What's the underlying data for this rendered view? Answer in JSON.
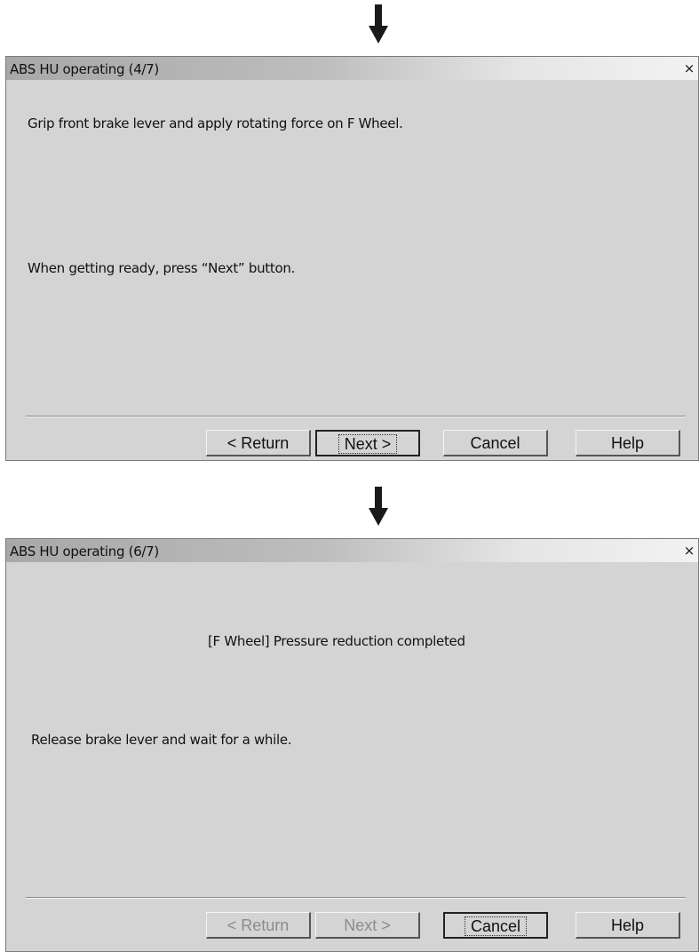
{
  "dialog1": {
    "title": "ABS HU operating (4/7)",
    "close_label": "×",
    "instruction": "Grip front brake lever and apply rotating force on F Wheel.",
    "prompt": "When getting ready, press “Next” button.",
    "buttons": {
      "return": "< Return",
      "next": "Next >",
      "cancel": "Cancel",
      "help": "Help"
    }
  },
  "dialog2": {
    "title": "ABS HU operating (6/7)",
    "close_label": "×",
    "status": "[F Wheel] Pressure reduction completed",
    "instruction": "Release brake lever and wait for a while.",
    "buttons": {
      "return": "< Return",
      "next": "Next >",
      "cancel": "Cancel",
      "help": "Help"
    }
  }
}
